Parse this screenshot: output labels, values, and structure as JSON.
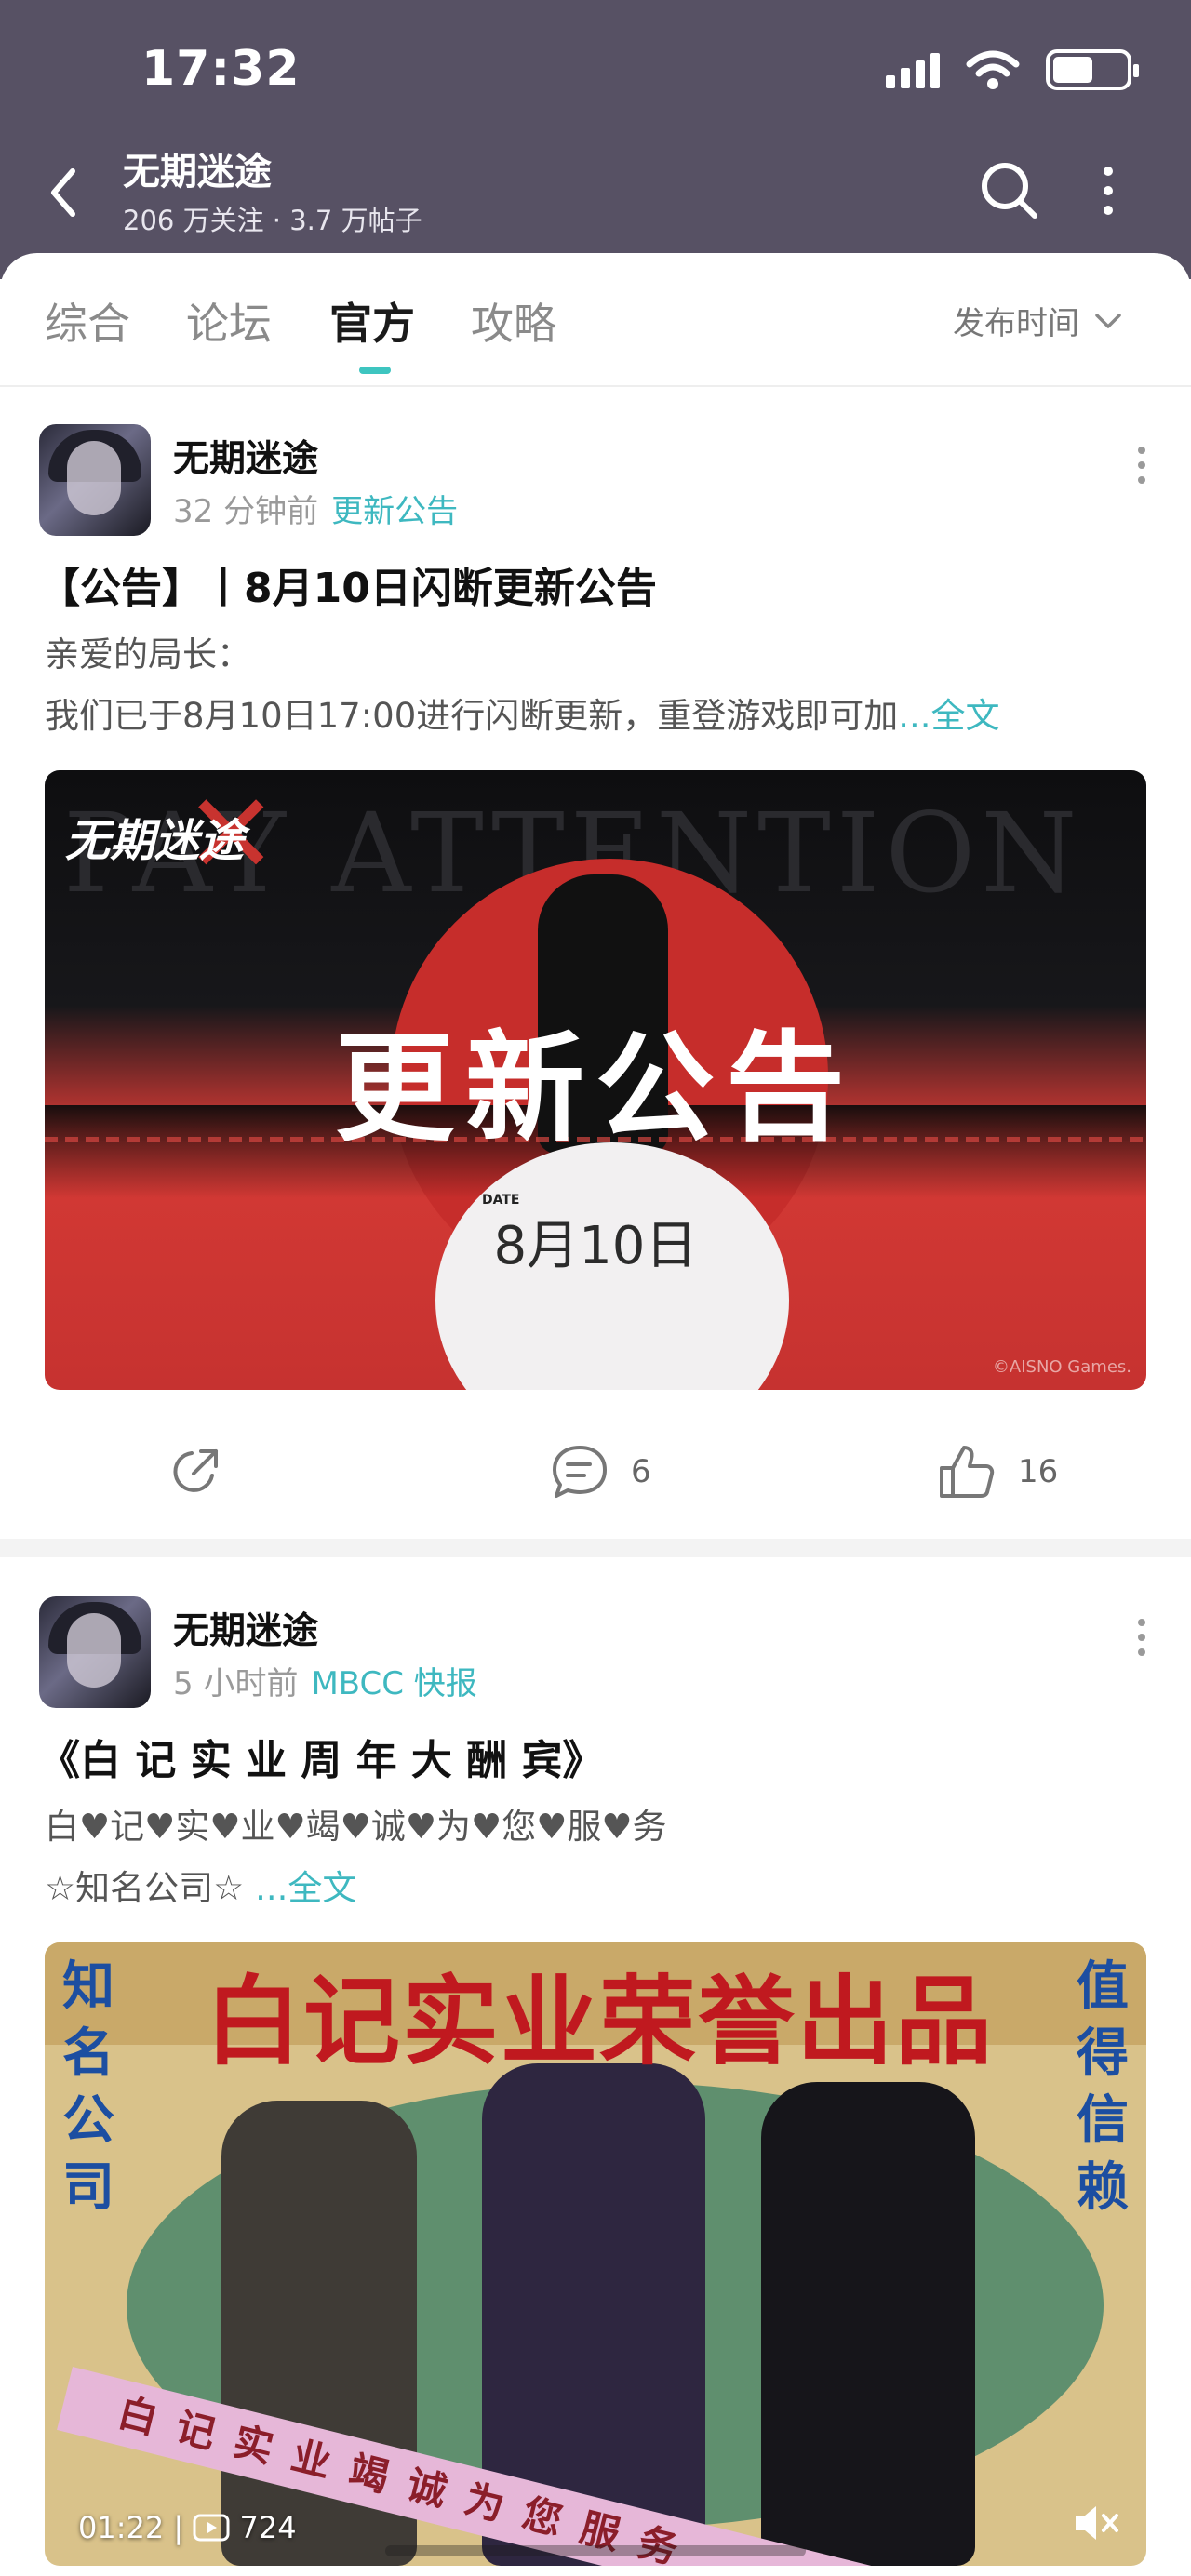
{
  "status_bar": {
    "time": "17:32"
  },
  "header": {
    "forum_name": "无期迷途",
    "forum_meta": "206 万关注 · 3.7 万帖子"
  },
  "tabs": [
    {
      "label": "综合",
      "active": false
    },
    {
      "label": "论坛",
      "active": false
    },
    {
      "label": "官方",
      "active": true
    },
    {
      "label": "攻略",
      "active": false
    }
  ],
  "sort": {
    "label": "发布时间"
  },
  "posts": [
    {
      "author": "无期迷途",
      "time": "32 分钟前",
      "tag": "更新公告",
      "title": "【公告】丨8月10日闪断更新公告",
      "body_line1": "亲爱的局长：",
      "body_line2": "我们已于8月10日17:00进行闪断更新，重登游戏即可加",
      "full_link": "...全文",
      "image": {
        "bg_text": "PAY ATTENTION",
        "logo": "无期迷途",
        "headline": "更新公告",
        "date_label": "DATE",
        "date": "8月10日",
        "copyright": "©AISNO Games."
      },
      "actions": {
        "comments": "6",
        "likes": "16"
      }
    },
    {
      "author": "无期迷途",
      "time": "5 小时前",
      "tag": "MBCC 快报",
      "title": "《白 记 实 业 周 年 大 酬 宾》",
      "body_line1": "白♥记♥实♥业♥竭♥诚♥为♥您♥服♥务",
      "body_line2": "☆知名公司☆ ",
      "full_link": "...全文",
      "video": {
        "big_title": "白记实业荣誉出品",
        "side_left": "知名公司",
        "side_right": "值得信赖",
        "ribbon": "白记实业竭诚为您服务",
        "duration": "01:22",
        "views": "724"
      }
    }
  ],
  "colors": {
    "header_bg": "#575164",
    "accent": "#3eb8c0"
  }
}
